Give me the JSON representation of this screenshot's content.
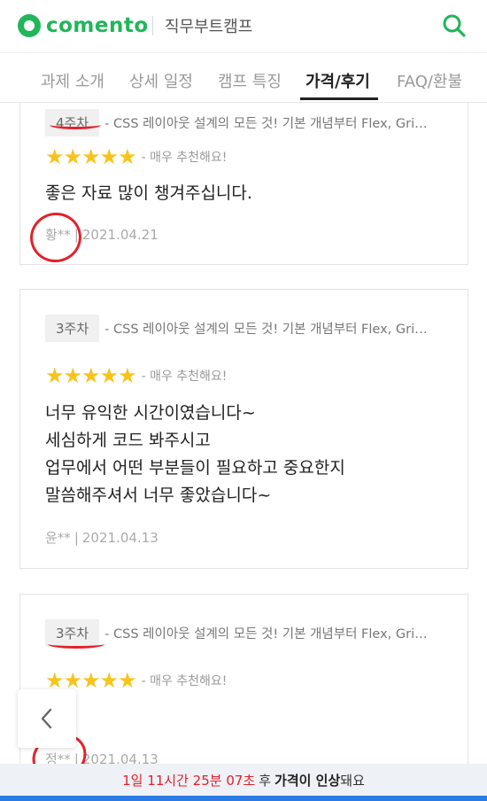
{
  "header": {
    "logo_text": "comento",
    "sub_brand": "직무부트캠프",
    "search_icon": "search-icon",
    "brand_color": "#20b65a"
  },
  "tabs": [
    {
      "label": "과제 소개",
      "active": false
    },
    {
      "label": "상세 일정",
      "active": false
    },
    {
      "label": "캠프 특징",
      "active": false
    },
    {
      "label": "가격/후기",
      "active": true
    },
    {
      "label": "FAQ/환불",
      "active": false
    }
  ],
  "reviews": [
    {
      "week": "4주차",
      "course": "- CSS 레이아웃 설계의 모든 것! 기본 개념부터 Flex, Gri…",
      "stars": "★★★★★",
      "rating_text": "- 매우 추천해요!",
      "body": "좋은 자료 많이 챙겨주십니다.",
      "author": "황**",
      "date": "2021.04.21"
    },
    {
      "week": "3주차",
      "course": "- CSS 레이아웃 설계의 모든 것! 기본 개념부터 Flex, Gri…",
      "stars": "★★★★★",
      "rating_text": "- 매우 추천해요!",
      "body": "너무 유익한 시간이였습니다~\n세심하게 코드 봐주시고\n업무에서 어떤 부분들이 필요하고 중요한지\n말씀해주셔서 너무 좋았습니다~",
      "author": "윤**",
      "date": "2021.04.13"
    },
    {
      "week": "3주차",
      "course": "- CSS 레이아웃 설계의 모든 것! 기본 개념부터 Flex, Gri…",
      "stars": "★★★★★",
      "rating_text": "- 매우 추천해요!",
      "body": "",
      "author": "정**",
      "date": "2021.04.13"
    }
  ],
  "back_button": {
    "icon": "chevron-left-icon"
  },
  "bottom_bar": {
    "timer": "1일 11시간 25분 07초",
    "after": "후",
    "strong": "가격이 인상",
    "tail": "돼요",
    "accent_color": "#e5202a"
  },
  "colors": {
    "star": "#f7c41e",
    "annotation": "#e5202a",
    "bottom_line": "#2a7be4"
  }
}
